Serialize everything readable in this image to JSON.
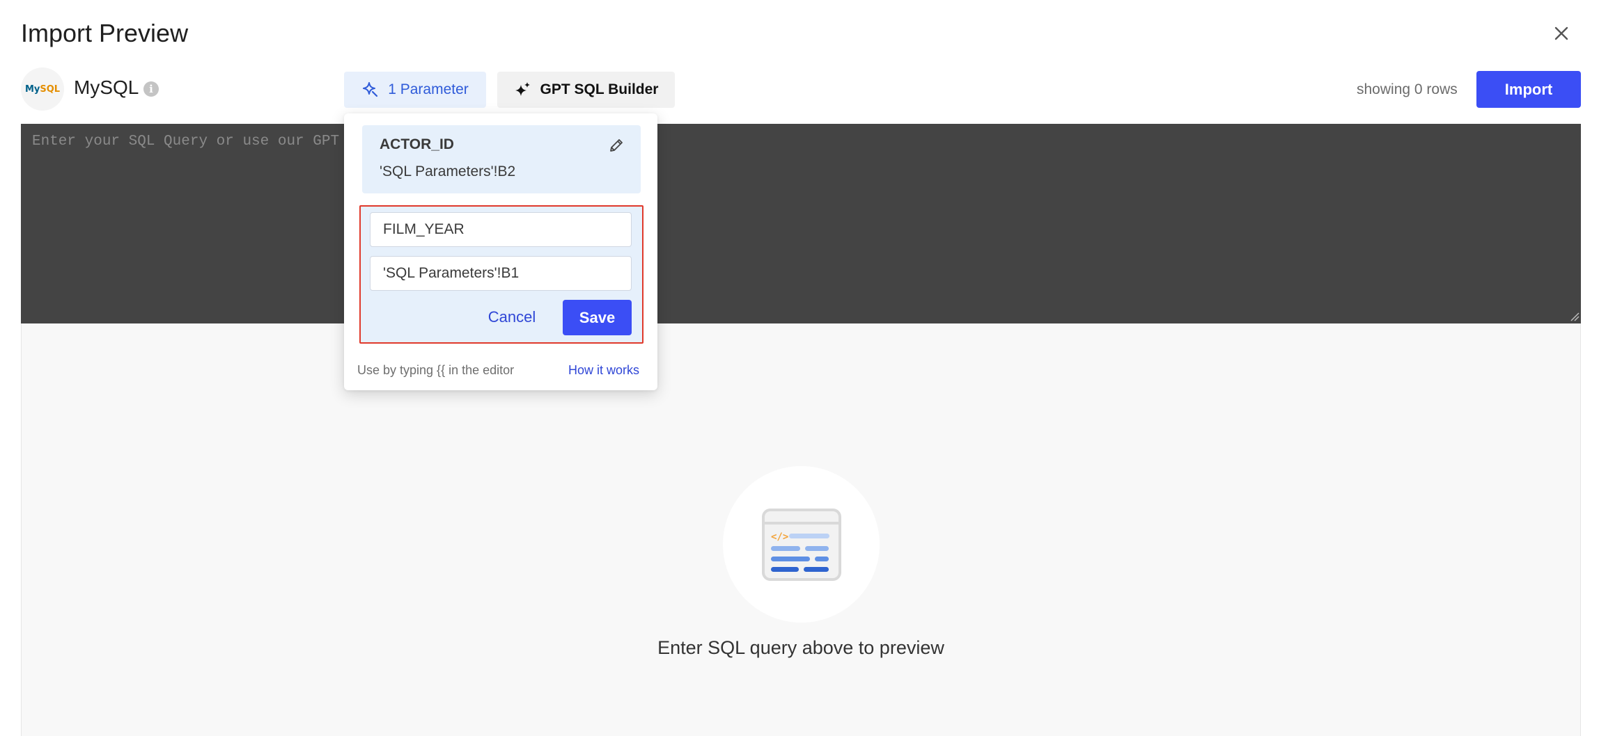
{
  "dialog": {
    "title": "Import Preview"
  },
  "source": {
    "logo_text_a": "My",
    "logo_text_b": "SQL",
    "name": "MySQL",
    "info_icon_glyph": "i"
  },
  "toolbar": {
    "parameters_label": "1 Parameter",
    "gpt_label": "GPT SQL Builder",
    "rows_status": "showing 0 rows",
    "import_label": "Import"
  },
  "editor": {
    "placeholder": "Enter your SQL Query or use our GPT SQL Builder"
  },
  "parameters_popover": {
    "existing": [
      {
        "name": "ACTOR_ID",
        "value": "'SQL Parameters'!B2"
      }
    ],
    "form": {
      "name_value": "FILM_YEAR",
      "value_value": "'SQL Parameters'!B1",
      "cancel_label": "Cancel",
      "save_label": "Save"
    },
    "hint": "Use by typing {{ in the editor",
    "how_it_works": "How it works"
  },
  "preview": {
    "empty_message": "Enter SQL query above to preview"
  },
  "icons": {
    "close": "close-icon",
    "info": "info-icon",
    "parameter": "sparkle-parameter-icon",
    "gpt": "sparkles-icon",
    "edit": "pencil-icon",
    "preview": "code-document-icon"
  },
  "colors": {
    "primary": "#3b4ef5",
    "link": "#2f46d6",
    "editor_bg": "#444444",
    "param_bg": "#e6f0fb",
    "highlight_border": "#e0392b"
  }
}
